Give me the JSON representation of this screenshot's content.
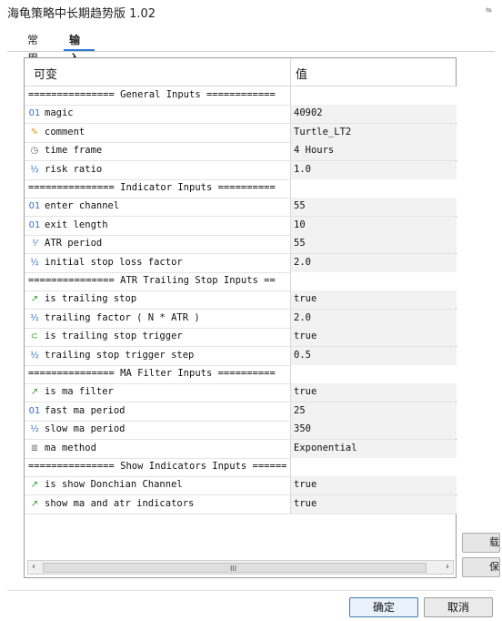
{
  "window": {
    "title": "海龟策略中长期趋势版 1.02",
    "title_icon": "window-control-icon"
  },
  "tabs": [
    {
      "label": "常用"
    },
    {
      "label": "输入"
    }
  ],
  "table": {
    "col_variable": "可变",
    "col_value": "值",
    "rows": [
      {
        "kind": "section",
        "name": "=============== General Inputs ============",
        "value": ""
      },
      {
        "kind": "param",
        "icon": "01",
        "icon_name": "integer-icon",
        "name": "magic",
        "value": "40902"
      },
      {
        "kind": "param",
        "icon": "✎",
        "icon_name": "string-icon",
        "name": "comment",
        "value": "Turtle_LT2"
      },
      {
        "kind": "param",
        "icon": "◷",
        "icon_name": "enum-icon",
        "name": "time frame",
        "value": "4 Hours"
      },
      {
        "kind": "param",
        "icon": "½",
        "icon_name": "double-icon",
        "name": "risk ratio",
        "value": "1.0"
      },
      {
        "kind": "section",
        "name": "=============== Indicator Inputs ==========",
        "value": ""
      },
      {
        "kind": "param",
        "icon": "01",
        "icon_name": "integer-icon",
        "name": "enter channel",
        "value": "55"
      },
      {
        "kind": "param",
        "icon": "01",
        "icon_name": "integer-icon",
        "name": "exit length",
        "value": "10"
      },
      {
        "kind": "param",
        "icon": "⅟",
        "icon_name": "double-icon",
        "name": "ATR period",
        "value": "55"
      },
      {
        "kind": "param",
        "icon": "½",
        "icon_name": "double-icon",
        "name": "initial stop loss factor",
        "value": "2.0"
      },
      {
        "kind": "section",
        "name": "=============== ATR Trailing Stop Inputs ==",
        "value": ""
      },
      {
        "kind": "param",
        "icon": "↗",
        "icon_name": "bool-icon",
        "name": "is trailing stop",
        "value": "true"
      },
      {
        "kind": "param",
        "icon": "½",
        "icon_name": "double-icon",
        "name": "trailing factor ( N * ATR )",
        "value": "2.0"
      },
      {
        "kind": "param",
        "icon": "⊂",
        "icon_name": "bool-icon",
        "name": "is trailing stop trigger",
        "value": "true"
      },
      {
        "kind": "param",
        "icon": "½",
        "icon_name": "double-icon",
        "name": "trailing stop trigger step",
        "value": "0.5"
      },
      {
        "kind": "section",
        "name": "=============== MA Filter Inputs ==========",
        "value": ""
      },
      {
        "kind": "param",
        "icon": "↗",
        "icon_name": "bool-icon",
        "name": "is ma filter",
        "value": "true"
      },
      {
        "kind": "param",
        "icon": "01",
        "icon_name": "integer-icon",
        "name": "fast ma period",
        "value": "25"
      },
      {
        "kind": "param",
        "icon": "½",
        "icon_name": "double-icon",
        "name": "slow ma period",
        "value": "350"
      },
      {
        "kind": "param",
        "icon": "≣",
        "icon_name": "enum-icon",
        "name": "ma method",
        "value": "Exponential"
      },
      {
        "kind": "section",
        "name": "=============== Show Indicators Inputs ======",
        "value": ""
      },
      {
        "kind": "param",
        "icon": "↗",
        "icon_name": "bool-icon",
        "name": "is show Donchian Channel",
        "value": "true"
      },
      {
        "kind": "param",
        "icon": "↗",
        "icon_name": "bool-icon",
        "name": "show ma and atr indicators",
        "value": "true"
      }
    ]
  },
  "scrollbar": {
    "left_arrow": "‹",
    "right_arrow": "›",
    "grip": "III"
  },
  "side_buttons": [
    {
      "label": "载"
    },
    {
      "label": "保"
    }
  ],
  "buttons": {
    "ok": "确定",
    "cancel": "取消"
  }
}
